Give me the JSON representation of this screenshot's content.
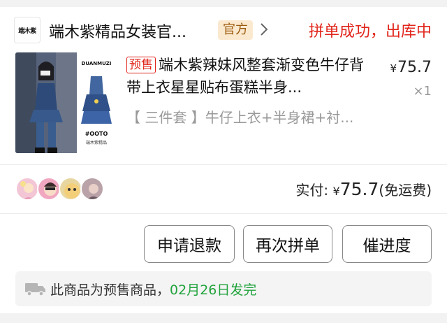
{
  "header": {
    "logo_text": "端木紫",
    "shop_name": "端木紫精品女装官...",
    "official_badge": "官方",
    "status": "拼单成功，出库中"
  },
  "product": {
    "thumb_brand": "DUANMUZI",
    "thumb_tag": "#OOTO",
    "thumb_tag2": "端木紫精品",
    "presale_badge": "预售",
    "title": "端木紫辣妹风整套渐变色牛仔背带上衣星星贴布蛋糕半身...",
    "spec": "【 三件套 】牛仔上衣+半身裙+衬...",
    "price_yen": "¥",
    "price": "75.7",
    "quantity": "×1"
  },
  "members": {
    "avatars": [
      "avatar-1",
      "avatar-2",
      "avatar-3",
      "avatar-4"
    ],
    "total_label": "实付:",
    "total_yen": "¥",
    "total_amount": "75.7",
    "shipping_note": "(免运费)"
  },
  "actions": {
    "refund": "申请退款",
    "rebuy": "再次拼单",
    "urge": "催进度"
  },
  "notice": {
    "text": "此商品为预售商品，",
    "date": "02月26日发完"
  },
  "colors": {
    "accent_red": "#e1251b",
    "official_bg": "#fbe9cf",
    "date_green": "#21a33c"
  }
}
